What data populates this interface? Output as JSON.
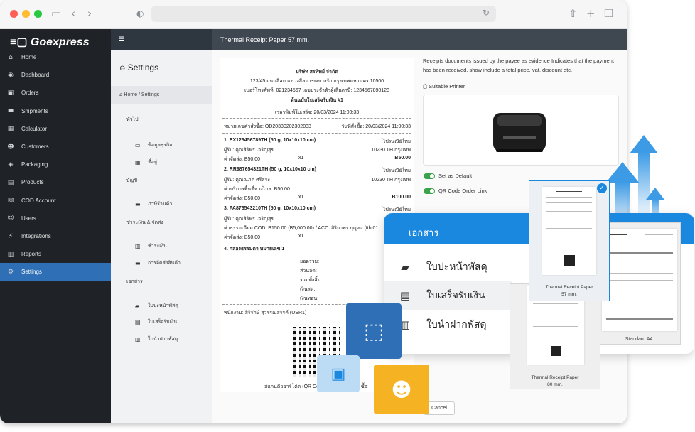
{
  "sidebar": {
    "logo": "Goexpress",
    "items": [
      {
        "label": "Home",
        "icon": "home-icon",
        "glyph": "⌂"
      },
      {
        "label": "Dashboard",
        "icon": "dashboard-icon",
        "glyph": "◉"
      },
      {
        "label": "Orders",
        "icon": "cart-icon",
        "glyph": "▣"
      },
      {
        "label": "Shipments",
        "icon": "truck-icon",
        "glyph": "▬"
      },
      {
        "label": "Calculator",
        "icon": "calculator-icon",
        "glyph": "▦"
      },
      {
        "label": "Customers",
        "icon": "users-icon",
        "glyph": "☻"
      },
      {
        "label": "Packaging",
        "icon": "box-icon",
        "glyph": "◈"
      },
      {
        "label": "Products",
        "icon": "products-icon",
        "glyph": "▤"
      },
      {
        "label": "COD Account",
        "icon": "wallet-icon",
        "glyph": "▧"
      },
      {
        "label": "Users",
        "icon": "user-group-icon",
        "glyph": "☺"
      },
      {
        "label": "Integrations",
        "icon": "plug-icon",
        "glyph": "⚡"
      },
      {
        "label": "Reports",
        "icon": "chart-icon",
        "glyph": "▥"
      },
      {
        "label": "Settings",
        "icon": "gear-icon",
        "glyph": "⚙"
      }
    ]
  },
  "settings_panel": {
    "title": "Settings",
    "breadcrumb": "Home / Settings",
    "groups": [
      {
        "label": "ทั่วไป",
        "items": [
          "ข้อมูลธุรกิจ",
          "ที่อยู่"
        ]
      },
      {
        "label": "บัญชี",
        "items": [
          "ภาษีร้านค้า"
        ]
      },
      {
        "label": "ชำระเงิน & จัดส่ง",
        "items": [
          "ชำระเงิน",
          "การจัดส่งสินค้า"
        ]
      },
      {
        "label": "เอกสาร",
        "items": [
          "ใบปะหน้าพัสดุ",
          "ใบเสร็จรับเงิน",
          "ใบนำฝากพัสดุ"
        ]
      }
    ]
  },
  "header": {
    "title": "Thermal Receipt Paper 57 mm."
  },
  "receipt": {
    "company": "บริษัท สรทิพย์ จำกัด",
    "address": "123/45 ถนนสีลม แขวงสีลม เขตบางรัก กรุงเทพมหานคร 10500",
    "contact": "เบอร์โทรศัพท์: 021234567 เลขประจำตัวผู้เสียภาษี: 1234567890123",
    "doc_title": "ต้นฉบับใบเสร็จรับเงิน #1",
    "print_time": "เวลาพิมพ์ใบเสร็จ: 20/03/2024 11:00:33",
    "order_no": "หมายเลขคำสั่งซื้อ: OD20330202302033",
    "order_date": "วันที่สั่งซื้อ: 20/03/2024 11:00:33",
    "items": [
      {
        "line1": "1. EX123456789TH (50 g, 10x10x10 cm)",
        "carrier": "ไปรษณีย์ไทย",
        "line2": "ผู้รับ: คุณสิริพร เจริญสุข",
        "dest": "10230 TH กรุงเทพ",
        "line3": "ค่าจัดส่ง: B50.00",
        "qty": "x1",
        "amount": "B50.00"
      },
      {
        "line1": "2. RR987654321TH (50 g, 10x10x10 cm)",
        "carrier": "ไปรษณีย์ไทย",
        "line2": "ผู้รับ: คุณณภค ศรีสระ",
        "dest": "10230 TH กรุงเทพ",
        "extra": "ค่าบริการพื้นที่ห่างไกล: B50.00",
        "line3": "ค่าจัดส่ง: B50.00",
        "qty": "x1",
        "amount": "B100.00"
      },
      {
        "line1": "3. PA876543210TH (50 g, 10x10x10 cm)",
        "carrier": "ไปรษณีย์ไทย",
        "line2": "ผู้รับ: คุณสิริพร เจริญสุข",
        "dest": "10230",
        "extra": "ค่าธรรมเนียม COD: B150.00 (B5,000.00) / ACC: สิริยาพร บุญส่ง (ttb 01",
        "line3": "ค่าจัดส่ง: B50.00",
        "qty": "x1",
        "amount": ""
      }
    ],
    "item4": "4. กล่องธรรมดา หมายเลข 1",
    "totals": [
      "ยอดรวม:",
      "ส่วนลด:",
      "รวมทั้งสิ้น:",
      "เงินสด:",
      "เงินทอน:"
    ],
    "staff": "พนักงาน: สิริรักษ์ สุวรรณสรรค์ (USR1)",
    "qr_caption_left": "สแกนคิวอาร์โค้ด (QR Co",
    "qr_caption_right": "ซื้อ"
  },
  "right_pane": {
    "description": "Receipts documents issued by the payee as evidence Indicates that the payment has been received. show include a total price, vat, discount etc.",
    "printer_label": "Suitable Printer",
    "set_default": "Set as Default",
    "qr_link": "QR Code Order Link",
    "cancel": "Cancel"
  },
  "doc_card": {
    "title": "เอกสาร",
    "options": [
      {
        "label": "ใบปะหน้าพัสดุ",
        "icon": "box-icon",
        "glyph": "▰"
      },
      {
        "label": "ใบเสร็จรับเงิน",
        "icon": "receipt-icon",
        "glyph": "▤"
      },
      {
        "label": "ใบนำฝากพัสดุ",
        "icon": "barcode-icon",
        "glyph": "▥"
      }
    ]
  },
  "thumbs": {
    "t57_line1": "Thermal Receipt Paper",
    "t57_line2": "57 mm.",
    "t80_line1": "Thermal Receipt Paper",
    "t80_line2": "80 mm.",
    "a4": "Standard A4"
  },
  "colors": {
    "accent": "#1b88e0",
    "sidebar": "#1f2328",
    "active": "#2f6fb6",
    "tile_blue": "#2f6fb6",
    "tile_light": "#bcdcf6",
    "tile_yellow": "#f5b324"
  }
}
